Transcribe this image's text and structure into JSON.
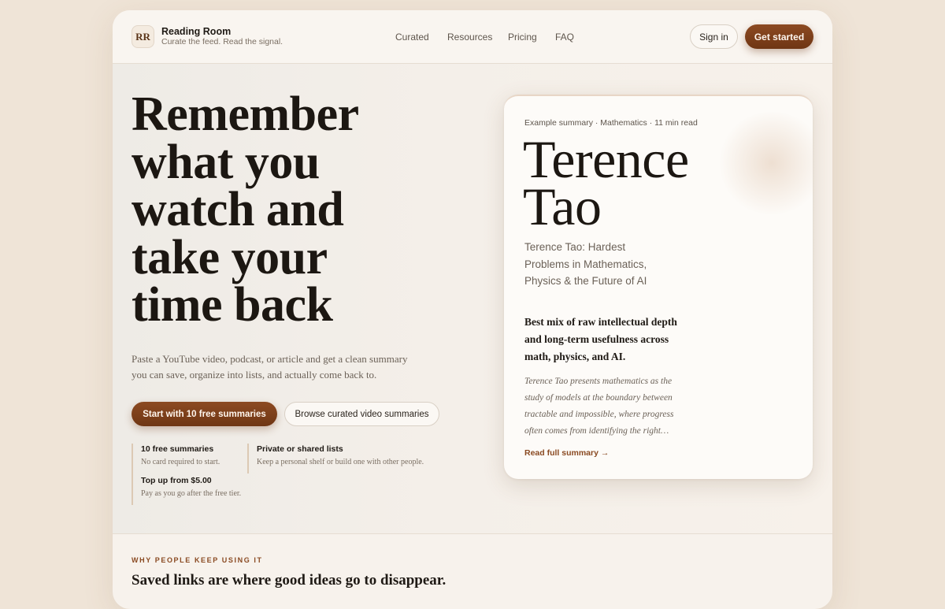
{
  "header": {
    "logo_text": "RR",
    "brand_name": "Reading Room",
    "brand_tagline": "Curate the feed. Read the signal.",
    "nav": [
      {
        "label": "Curated"
      },
      {
        "label": "Resources"
      },
      {
        "label": "Pricing"
      },
      {
        "label": "FAQ"
      }
    ],
    "signin_label": "Sign in",
    "get_started_label": "Get started"
  },
  "hero": {
    "headline": "Remember what you watch and take your time back",
    "lede": "Paste a YouTube video, podcast, or article and get a clean summary you can save, organize into lists, and actually come back to.",
    "primary_cta": "Start with 10 free summaries",
    "secondary_cta": "Browse curated video summaries",
    "features": [
      {
        "title": "10 free summaries",
        "desc": "No card required to start."
      },
      {
        "title": "Private or shared lists",
        "desc": "Keep a personal shelf or build one with other people."
      },
      {
        "title": "Top up from $5.00",
        "desc": "Pay as you go after the free tier."
      }
    ]
  },
  "example_card": {
    "meta": "Example summary · Mathematics · 11 min read",
    "title": "Terence Tao",
    "subtitle": "Terence Tao: Hardest Problems in Mathematics, Physics & the Future of AI",
    "verdict": "Best mix of raw intellectual depth and long-term usefulness across math, physics, and AI.",
    "excerpt": "Terence Tao presents mathematics as the study of models at the boundary between tractable and impossible, where progress often comes from identifying the right…",
    "link_label": "Read full summary →"
  },
  "why_section": {
    "eyebrow": "WHY PEOPLE KEEP USING IT",
    "heading": "Saved links are where good ideas go to disappear."
  },
  "colors": {
    "accent": "#7a3d19",
    "page_bg": "#efe4d7",
    "frame_bg": "#f7f2ec"
  }
}
